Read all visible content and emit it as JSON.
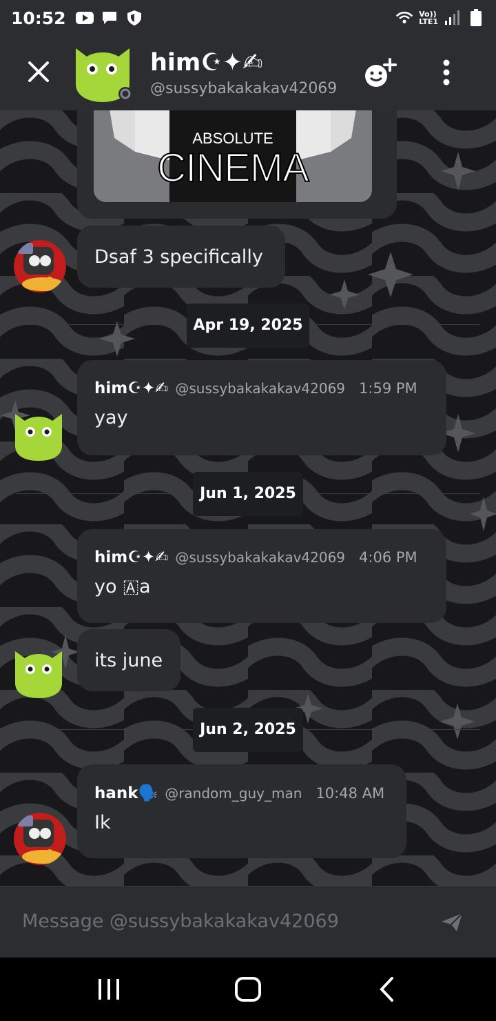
{
  "status_bar": {
    "time": "10:52",
    "network_label_top": "Vo))",
    "network_label_bottom": "LTE1",
    "icons": [
      "youtube-icon",
      "chat-icon",
      "shield-icon",
      "wifi-icon",
      "signal-icon",
      "battery-icon"
    ]
  },
  "header": {
    "display_name": "him☪✦✍",
    "handle": "@sussybakakakav42069",
    "icons": [
      "close-icon",
      "add-friend-icon",
      "more-options-icon"
    ]
  },
  "messages": {
    "image_caption_top": "ABSOLUTE",
    "image_caption_bottom": "CINEMA",
    "msg_dsaf": "Dsaf 3 specifically",
    "date_1": "Apr 19, 2025",
    "group_1": {
      "author": "him☪✦✍",
      "handle": "@sussybakakakav42069",
      "time": "1:59 PM",
      "text": "yay"
    },
    "date_2": "Jun 1, 2025",
    "group_2": {
      "author": "him☪✦✍",
      "handle": "@sussybakakakav42069",
      "time": "4:06 PM",
      "text": "yo 🇦a",
      "text2": "its june"
    },
    "date_3": "Jun 2, 2025",
    "group_3": {
      "author": "hank🗣️",
      "handle": "@random_guy_man",
      "time": "10:48 AM",
      "text": "Ik"
    }
  },
  "composer": {
    "placeholder": "Message @sussybakakakav42069"
  },
  "colors": {
    "bubble": "#2a2c30",
    "header": "#2b2d31",
    "avatar_green": "#a6d73a",
    "muted_text": "#a5a7ab"
  }
}
